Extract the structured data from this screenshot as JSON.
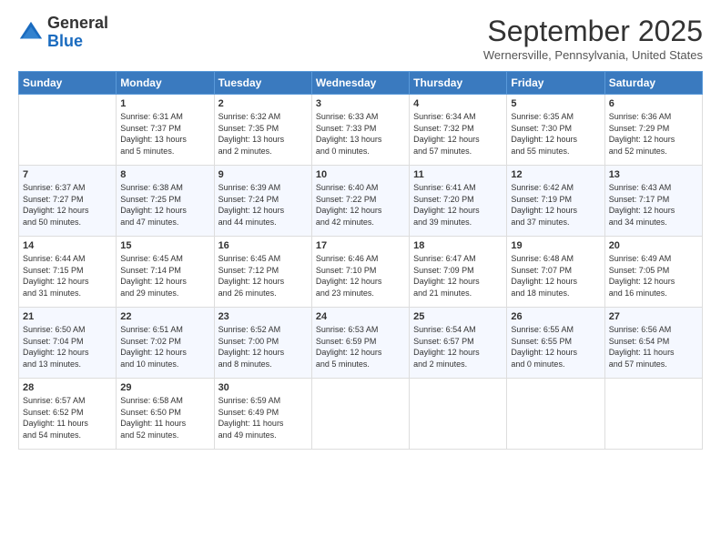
{
  "header": {
    "logo_general": "General",
    "logo_blue": "Blue",
    "month": "September 2025",
    "location": "Wernersville, Pennsylvania, United States"
  },
  "days_of_week": [
    "Sunday",
    "Monday",
    "Tuesday",
    "Wednesday",
    "Thursday",
    "Friday",
    "Saturday"
  ],
  "weeks": [
    [
      {
        "num": "",
        "lines": []
      },
      {
        "num": "1",
        "lines": [
          "Sunrise: 6:31 AM",
          "Sunset: 7:37 PM",
          "Daylight: 13 hours",
          "and 5 minutes."
        ]
      },
      {
        "num": "2",
        "lines": [
          "Sunrise: 6:32 AM",
          "Sunset: 7:35 PM",
          "Daylight: 13 hours",
          "and 2 minutes."
        ]
      },
      {
        "num": "3",
        "lines": [
          "Sunrise: 6:33 AM",
          "Sunset: 7:33 PM",
          "Daylight: 13 hours",
          "and 0 minutes."
        ]
      },
      {
        "num": "4",
        "lines": [
          "Sunrise: 6:34 AM",
          "Sunset: 7:32 PM",
          "Daylight: 12 hours",
          "and 57 minutes."
        ]
      },
      {
        "num": "5",
        "lines": [
          "Sunrise: 6:35 AM",
          "Sunset: 7:30 PM",
          "Daylight: 12 hours",
          "and 55 minutes."
        ]
      },
      {
        "num": "6",
        "lines": [
          "Sunrise: 6:36 AM",
          "Sunset: 7:29 PM",
          "Daylight: 12 hours",
          "and 52 minutes."
        ]
      }
    ],
    [
      {
        "num": "7",
        "lines": [
          "Sunrise: 6:37 AM",
          "Sunset: 7:27 PM",
          "Daylight: 12 hours",
          "and 50 minutes."
        ]
      },
      {
        "num": "8",
        "lines": [
          "Sunrise: 6:38 AM",
          "Sunset: 7:25 PM",
          "Daylight: 12 hours",
          "and 47 minutes."
        ]
      },
      {
        "num": "9",
        "lines": [
          "Sunrise: 6:39 AM",
          "Sunset: 7:24 PM",
          "Daylight: 12 hours",
          "and 44 minutes."
        ]
      },
      {
        "num": "10",
        "lines": [
          "Sunrise: 6:40 AM",
          "Sunset: 7:22 PM",
          "Daylight: 12 hours",
          "and 42 minutes."
        ]
      },
      {
        "num": "11",
        "lines": [
          "Sunrise: 6:41 AM",
          "Sunset: 7:20 PM",
          "Daylight: 12 hours",
          "and 39 minutes."
        ]
      },
      {
        "num": "12",
        "lines": [
          "Sunrise: 6:42 AM",
          "Sunset: 7:19 PM",
          "Daylight: 12 hours",
          "and 37 minutes."
        ]
      },
      {
        "num": "13",
        "lines": [
          "Sunrise: 6:43 AM",
          "Sunset: 7:17 PM",
          "Daylight: 12 hours",
          "and 34 minutes."
        ]
      }
    ],
    [
      {
        "num": "14",
        "lines": [
          "Sunrise: 6:44 AM",
          "Sunset: 7:15 PM",
          "Daylight: 12 hours",
          "and 31 minutes."
        ]
      },
      {
        "num": "15",
        "lines": [
          "Sunrise: 6:45 AM",
          "Sunset: 7:14 PM",
          "Daylight: 12 hours",
          "and 29 minutes."
        ]
      },
      {
        "num": "16",
        "lines": [
          "Sunrise: 6:45 AM",
          "Sunset: 7:12 PM",
          "Daylight: 12 hours",
          "and 26 minutes."
        ]
      },
      {
        "num": "17",
        "lines": [
          "Sunrise: 6:46 AM",
          "Sunset: 7:10 PM",
          "Daylight: 12 hours",
          "and 23 minutes."
        ]
      },
      {
        "num": "18",
        "lines": [
          "Sunrise: 6:47 AM",
          "Sunset: 7:09 PM",
          "Daylight: 12 hours",
          "and 21 minutes."
        ]
      },
      {
        "num": "19",
        "lines": [
          "Sunrise: 6:48 AM",
          "Sunset: 7:07 PM",
          "Daylight: 12 hours",
          "and 18 minutes."
        ]
      },
      {
        "num": "20",
        "lines": [
          "Sunrise: 6:49 AM",
          "Sunset: 7:05 PM",
          "Daylight: 12 hours",
          "and 16 minutes."
        ]
      }
    ],
    [
      {
        "num": "21",
        "lines": [
          "Sunrise: 6:50 AM",
          "Sunset: 7:04 PM",
          "Daylight: 12 hours",
          "and 13 minutes."
        ]
      },
      {
        "num": "22",
        "lines": [
          "Sunrise: 6:51 AM",
          "Sunset: 7:02 PM",
          "Daylight: 12 hours",
          "and 10 minutes."
        ]
      },
      {
        "num": "23",
        "lines": [
          "Sunrise: 6:52 AM",
          "Sunset: 7:00 PM",
          "Daylight: 12 hours",
          "and 8 minutes."
        ]
      },
      {
        "num": "24",
        "lines": [
          "Sunrise: 6:53 AM",
          "Sunset: 6:59 PM",
          "Daylight: 12 hours",
          "and 5 minutes."
        ]
      },
      {
        "num": "25",
        "lines": [
          "Sunrise: 6:54 AM",
          "Sunset: 6:57 PM",
          "Daylight: 12 hours",
          "and 2 minutes."
        ]
      },
      {
        "num": "26",
        "lines": [
          "Sunrise: 6:55 AM",
          "Sunset: 6:55 PM",
          "Daylight: 12 hours",
          "and 0 minutes."
        ]
      },
      {
        "num": "27",
        "lines": [
          "Sunrise: 6:56 AM",
          "Sunset: 6:54 PM",
          "Daylight: 11 hours",
          "and 57 minutes."
        ]
      }
    ],
    [
      {
        "num": "28",
        "lines": [
          "Sunrise: 6:57 AM",
          "Sunset: 6:52 PM",
          "Daylight: 11 hours",
          "and 54 minutes."
        ]
      },
      {
        "num": "29",
        "lines": [
          "Sunrise: 6:58 AM",
          "Sunset: 6:50 PM",
          "Daylight: 11 hours",
          "and 52 minutes."
        ]
      },
      {
        "num": "30",
        "lines": [
          "Sunrise: 6:59 AM",
          "Sunset: 6:49 PM",
          "Daylight: 11 hours",
          "and 49 minutes."
        ]
      },
      {
        "num": "",
        "lines": []
      },
      {
        "num": "",
        "lines": []
      },
      {
        "num": "",
        "lines": []
      },
      {
        "num": "",
        "lines": []
      }
    ]
  ]
}
